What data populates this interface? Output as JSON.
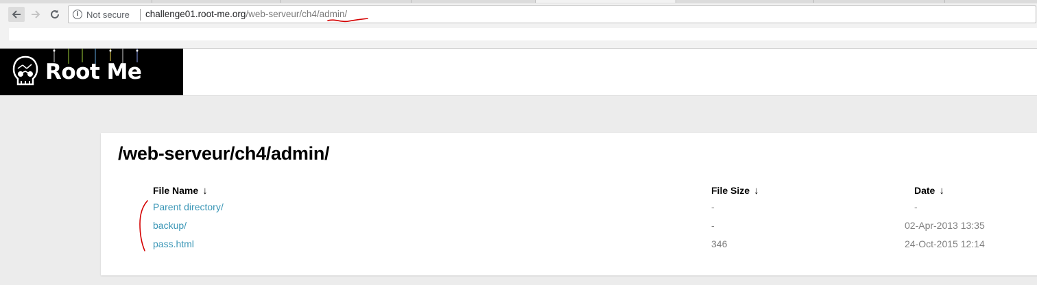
{
  "browser": {
    "back_icon": "arrow-left-icon",
    "forward_icon": "arrow-right-icon",
    "reload_icon": "reload-icon",
    "security_icon": "info-icon",
    "security_label": "Not secure",
    "url_host": "challenge01.root-me.org",
    "url_path": "/web-serveur/ch4/admin/"
  },
  "site": {
    "logo_text": "Root Me"
  },
  "listing": {
    "title": "/web-serveur/ch4/admin/",
    "columns": {
      "name": "File Name",
      "size": "File Size",
      "date": "Date",
      "sort_arrow": "↓"
    },
    "rows": [
      {
        "name": "Parent directory/",
        "size": "-",
        "date": "-"
      },
      {
        "name": "backup/",
        "size": "-",
        "date": "02-Apr-2013 13:35"
      },
      {
        "name": "pass.html",
        "size": "346",
        "date": "24-Oct-2015 12:14"
      }
    ]
  },
  "colors": {
    "link": "#3a96b6",
    "annotation_red": "#d40000",
    "page_bg": "#ececec"
  }
}
